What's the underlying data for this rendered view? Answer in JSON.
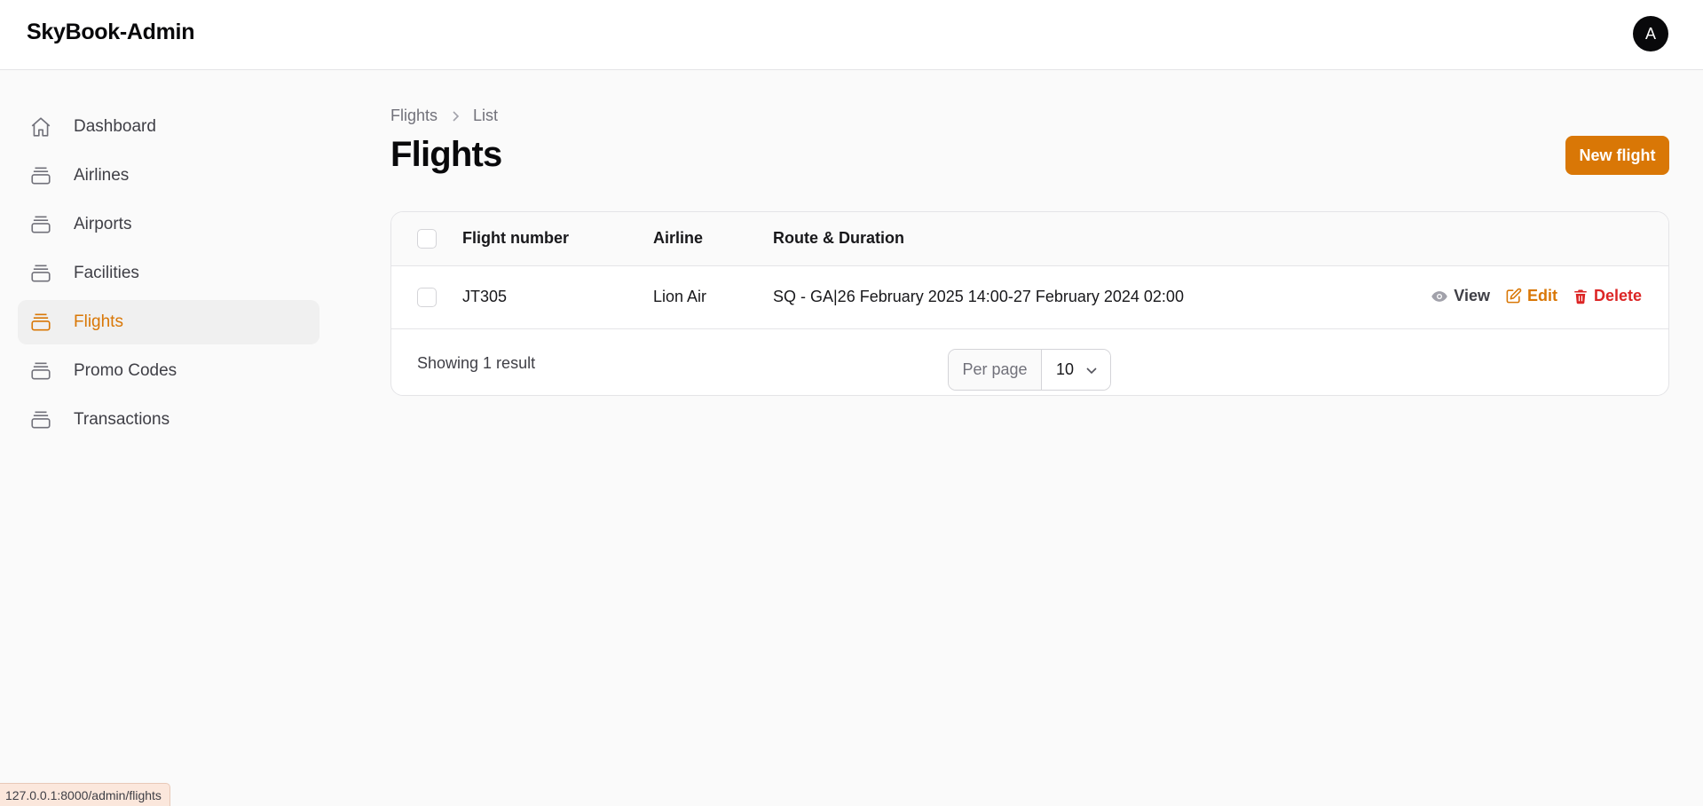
{
  "app": {
    "brand": "SkyBook-Admin",
    "avatar_initial": "A"
  },
  "sidebar": {
    "items": [
      {
        "label": "Dashboard",
        "icon": "home-icon",
        "active": false
      },
      {
        "label": "Airlines",
        "icon": "stack-icon",
        "active": false
      },
      {
        "label": "Airports",
        "icon": "stack-icon",
        "active": false
      },
      {
        "label": "Facilities",
        "icon": "stack-icon",
        "active": false
      },
      {
        "label": "Flights",
        "icon": "stack-icon",
        "active": true
      },
      {
        "label": "Promo Codes",
        "icon": "stack-icon",
        "active": false
      },
      {
        "label": "Transactions",
        "icon": "stack-icon",
        "active": false
      }
    ]
  },
  "breadcrumb": {
    "items": [
      "Flights",
      "List"
    ]
  },
  "page": {
    "title": "Flights",
    "new_button_label": "New flight"
  },
  "table": {
    "columns": [
      "Flight number",
      "Airline",
      "Route & Duration"
    ],
    "rows": [
      {
        "flight_number": "JT305",
        "airline": "Lion Air",
        "route_duration": "SQ - GA|26 February 2025 14:00-27 February 2024 02:00",
        "actions": {
          "view": "View",
          "edit": "Edit",
          "delete": "Delete"
        }
      }
    ],
    "footer": {
      "showing": "Showing 1 result",
      "per_page_label": "Per page",
      "per_page_value": "10"
    }
  },
  "status_bar": {
    "url": "127.0.0.1:8000/admin/flights"
  },
  "colors": {
    "accent": "#d97706",
    "danger": "#dc2626",
    "text": "#18181b",
    "muted": "#71717a"
  }
}
